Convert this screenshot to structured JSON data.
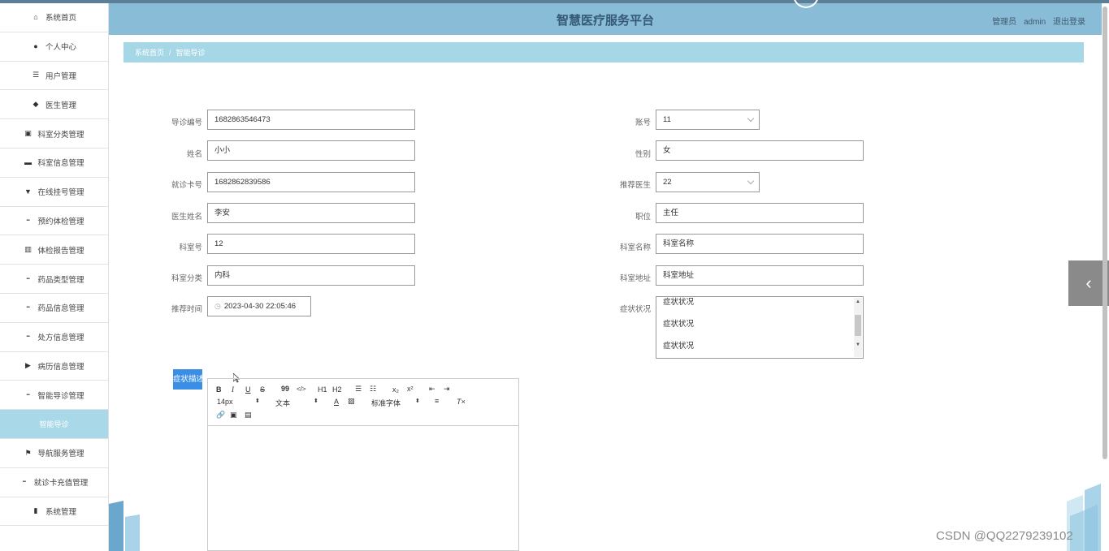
{
  "header": {
    "title": "智慧医疗服务平台",
    "user_role": "管理员",
    "user_name": "admin",
    "logout": "退出登录"
  },
  "sidebar": {
    "items": [
      {
        "label": "系统首页",
        "icon": "home-icon"
      },
      {
        "label": "个人中心",
        "icon": "user-icon"
      },
      {
        "label": "用户管理",
        "icon": "list-icon"
      },
      {
        "label": "医生管理",
        "icon": "leaf-icon"
      },
      {
        "label": "科室分类管理",
        "icon": "clipboard-icon"
      },
      {
        "label": "科室信息管理",
        "icon": "briefcase-icon"
      },
      {
        "label": "在线挂号管理",
        "icon": "pin-icon"
      },
      {
        "label": "预约体检管理",
        "icon": "grid-icon"
      },
      {
        "label": "体检报告管理",
        "icon": "building-icon"
      },
      {
        "label": "药品类型管理",
        "icon": "grid-icon"
      },
      {
        "label": "药品信息管理",
        "icon": "grid-icon"
      },
      {
        "label": "处方信息管理",
        "icon": "grid-icon"
      },
      {
        "label": "病历信息管理",
        "icon": "video-icon"
      },
      {
        "label": "智能导诊管理",
        "icon": "grid-icon"
      },
      {
        "label": "智能导诊",
        "icon": "",
        "sub": true
      },
      {
        "label": "导航服务管理",
        "icon": "flag-icon"
      },
      {
        "label": "就诊卡充值管理",
        "icon": "grid-icon"
      },
      {
        "label": "系统管理",
        "icon": "bar-chart-icon"
      }
    ]
  },
  "breadcrumb": {
    "home": "系统首页",
    "separator": "/",
    "current": "智能导诊"
  },
  "form": {
    "guide_no": {
      "label": "导诊编号",
      "value": "1682863546473"
    },
    "name": {
      "label": "姓名",
      "value": "小小"
    },
    "card_no": {
      "label": "就诊卡号",
      "value": "1682862839586"
    },
    "doctor_name": {
      "label": "医生姓名",
      "value": "李安"
    },
    "dept_no": {
      "label": "科室号",
      "value": "12"
    },
    "dept_category": {
      "label": "科室分类",
      "value": "内科"
    },
    "recommend_time": {
      "label": "推荐时间",
      "value": "2023-04-30 22:05:46"
    },
    "account": {
      "label": "账号",
      "value": "11"
    },
    "gender": {
      "label": "性别",
      "value": "女"
    },
    "recommend_doctor": {
      "label": "推荐医生",
      "value": "22"
    },
    "position": {
      "label": "职位",
      "value": "主任"
    },
    "dept_name": {
      "label": "科室名称",
      "value": "科室名称"
    },
    "dept_address": {
      "label": "科室地址",
      "value": "科室地址"
    },
    "symptoms": {
      "label": "症状状况",
      "lines": [
        "症状状况",
        "症状状况",
        "症状状况"
      ]
    },
    "symptom_desc": {
      "label": "症状描述"
    }
  },
  "editor": {
    "bold": "B",
    "italic": "I",
    "underline": "U",
    "strike": "S",
    "quote": "99",
    "code": "</>",
    "h1": "H1",
    "h2": "H2",
    "sub": "x₂",
    "sup": "x²",
    "font_size": "14px",
    "text_type": "文本",
    "font_family": "标准字体",
    "font_color": "A"
  },
  "watermark": "CSDN @QQ2279239102"
}
